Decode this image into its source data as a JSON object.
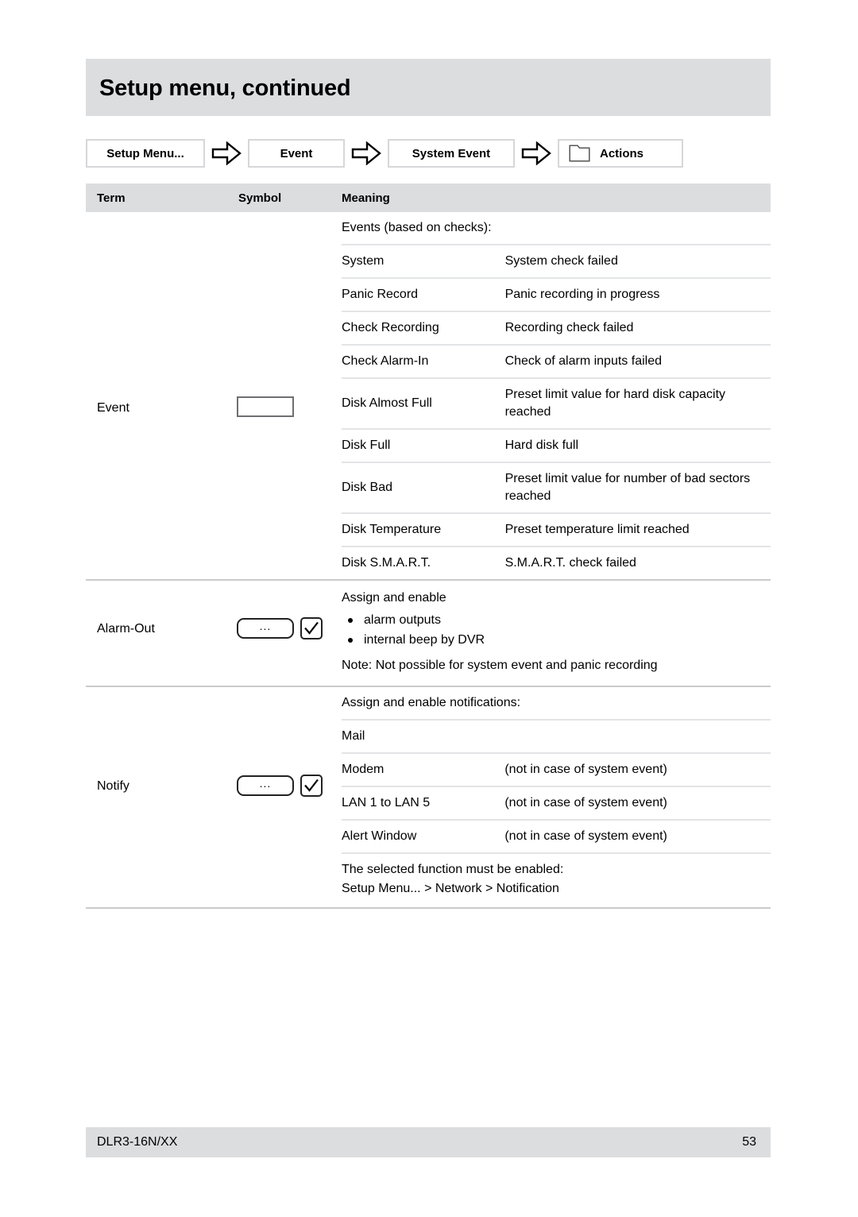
{
  "document": {
    "title": "Setup menu, continued"
  },
  "breadcrumb": {
    "items": [
      {
        "label": "Setup Menu...",
        "icon": ""
      },
      {
        "label": "Event",
        "icon": ""
      },
      {
        "label": "System Event",
        "icon": ""
      },
      {
        "label": "Actions",
        "icon": "folder-icon"
      }
    ],
    "separator_icon": "right-arrow-icon"
  },
  "table": {
    "headers": {
      "term": "Term",
      "symbol": "Symbol",
      "meaning": "Meaning"
    },
    "sections": [
      {
        "term": "Event",
        "symbol": {
          "type": "empty-box"
        },
        "intro": "Events (based on checks):",
        "rows": [
          {
            "name": "System",
            "desc": "System check failed"
          },
          {
            "name": "Panic Record",
            "desc": "Panic recording in progress"
          },
          {
            "name": "Check Recording",
            "desc": "Recording check failed"
          },
          {
            "name": "Check Alarm-In",
            "desc": "Check of alarm inputs failed"
          },
          {
            "name": "Disk Almost Full",
            "desc": "Preset limit value for hard disk capacity reached"
          },
          {
            "name": "Disk Full",
            "desc": "Hard disk full"
          },
          {
            "name": "Disk Bad",
            "desc": "Preset limit value for number of bad sectors reached"
          },
          {
            "name": "Disk Temperature",
            "desc": "Preset temperature limit reached"
          },
          {
            "name": "Disk  S.M.A.R.T.",
            "desc": "S.M.A.R.T. check failed"
          }
        ]
      },
      {
        "term": "Alarm-Out",
        "symbol": {
          "type": "dots-and-check",
          "dots": "...",
          "check": "checkmark-icon"
        },
        "intro": "Assign and enable",
        "bullets": [
          "alarm outputs",
          "internal beep by DVR"
        ],
        "note": "Note: Not possible for system event and panic recording"
      },
      {
        "term": "Notify",
        "symbol": {
          "type": "dots-and-check",
          "dots": "...",
          "check": "checkmark-icon"
        },
        "intro": "Assign and enable notifications:",
        "rows": [
          {
            "name": "Mail",
            "desc": ""
          },
          {
            "name": "Modem",
            "desc": "(not in case of system event)"
          },
          {
            "name": "LAN 1 to LAN 5",
            "desc": "(not in case of system event)"
          },
          {
            "name": "Alert Window",
            "desc": "(not in case of system event)"
          }
        ],
        "footnote_1": "The selected function must be enabled:",
        "footnote_2": "Setup Menu... > Network > Notification"
      }
    ]
  },
  "footer": {
    "model": "DLR3-16N/XX",
    "page_number": "53"
  },
  "colors": {
    "band_gray": "#dcdddf",
    "rule_gray": "#e3e4e6",
    "section_rule": "#c9cacc"
  }
}
